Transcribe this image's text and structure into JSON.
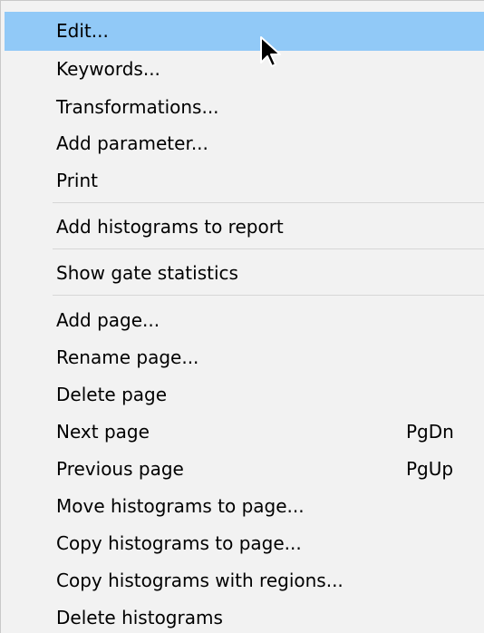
{
  "menu": {
    "items": [
      {
        "label": "Edit...",
        "shortcut": ""
      },
      {
        "label": "Keywords...",
        "shortcut": ""
      },
      {
        "label": "Transformations...",
        "shortcut": ""
      },
      {
        "label": "Add parameter...",
        "shortcut": ""
      },
      {
        "label": "Print",
        "shortcut": ""
      },
      {
        "label": "Add histograms to report",
        "shortcut": ""
      },
      {
        "label": "Show gate statistics",
        "shortcut": ""
      },
      {
        "label": "Add page...",
        "shortcut": ""
      },
      {
        "label": "Rename page...",
        "shortcut": ""
      },
      {
        "label": "Delete page",
        "shortcut": ""
      },
      {
        "label": "Next page",
        "shortcut": "PgDn"
      },
      {
        "label": "Previous page",
        "shortcut": "PgUp"
      },
      {
        "label": "Move histograms to page...",
        "shortcut": ""
      },
      {
        "label": "Copy histograms to page...",
        "shortcut": ""
      },
      {
        "label": "Copy histograms with regions...",
        "shortcut": ""
      },
      {
        "label": "Delete histograms",
        "shortcut": ""
      }
    ],
    "highlighted_index": 0,
    "highlight_color": "#91c9f7",
    "background_color": "#f2f2f2"
  },
  "cursor": {
    "icon": "arrow-pointer-icon"
  }
}
